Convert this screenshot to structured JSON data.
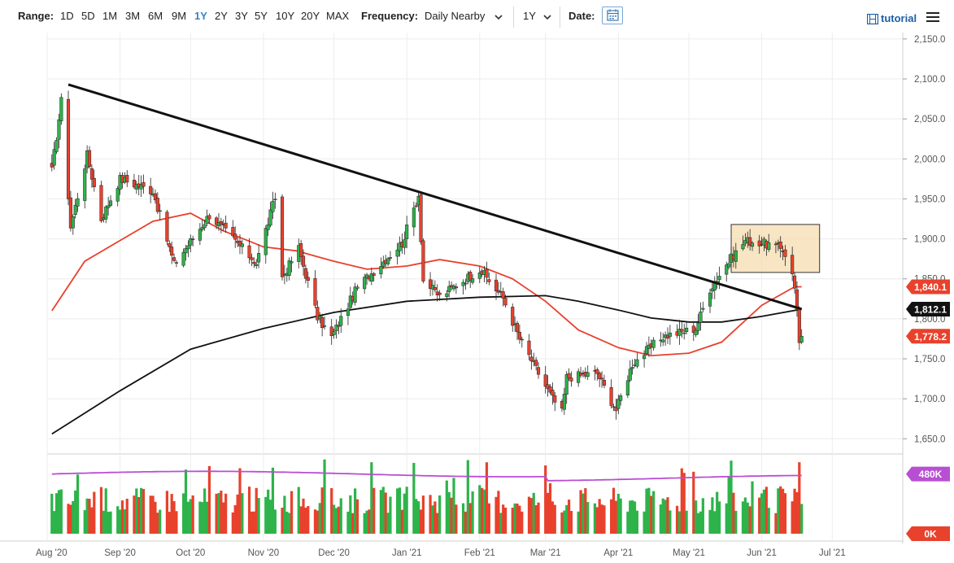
{
  "toolbar": {
    "range_label": "Range:",
    "ranges": [
      "1D",
      "5D",
      "1M",
      "3M",
      "6M",
      "9M",
      "1Y",
      "2Y",
      "3Y",
      "5Y",
      "10Y",
      "20Y",
      "MAX"
    ],
    "active_range": "1Y",
    "frequency_label": "Frequency:",
    "frequency_value": "Daily Nearby",
    "period_value": "1Y",
    "date_label": "Date:",
    "tutorial_label": "tutorial"
  },
  "icons": [
    "calendar-icon",
    "film-icon",
    "menu-icon",
    "trend-line-icon",
    "fib-lines-icon",
    "shape-icon",
    "arrow-up-icon",
    "circle-one-icon",
    "pitchfork-icon",
    "magnet-icon",
    "chevron-right-icon",
    "chevron-down-icon"
  ],
  "colors": {
    "up": "#2db34a",
    "down": "#e8412c",
    "ma_fast": "#e8412c",
    "ma_slow": "#111111",
    "vol_ma": "#b84fd3",
    "accent": "#1a5fa8",
    "box_fill": "#f6dcb0",
    "box_stroke": "#333333"
  },
  "chart_data": {
    "type": "candlestick",
    "price_axis": {
      "ticks": [
        1650,
        1700,
        1750,
        1800,
        1850,
        1900,
        1950,
        2000,
        2050,
        2100,
        2150
      ],
      "tick_labels": [
        "1,650.0",
        "1,700.0",
        "1,750.0",
        "1,800.0",
        "1,850.0",
        "1,900.0",
        "1,950.0",
        "2,000.0",
        "2,050.0",
        "2,100.0",
        "2,150.0"
      ],
      "range": [
        1632,
        2158
      ]
    },
    "x_axis": {
      "labels": [
        "Aug '20",
        "Sep '20",
        "Oct '20",
        "Nov '20",
        "Dec '20",
        "Jan '21",
        "Feb '21",
        "Mar '21",
        "Apr '21",
        "May '21",
        "Jun '21",
        "Jul '21"
      ],
      "range_dates": [
        "2020-08-01",
        "2021-07-31"
      ]
    },
    "price_tags": [
      {
        "value": 1840.1,
        "label": "1,840.1",
        "color": "#e8412c"
      },
      {
        "value": 1812.1,
        "label": "1,812.1",
        "color": "#111111"
      },
      {
        "value": 1778.2,
        "label": "1,778.2",
        "color": "#e8412c"
      }
    ],
    "volume_tags": [
      {
        "label": "480K",
        "color": "#b84fd3"
      },
      {
        "label": "0K",
        "color": "#e8412c"
      }
    ],
    "volume_axis": {
      "max": 540
    },
    "series": [
      {
        "name": "price",
        "type": "candlestick",
        "start": "2020-08-03",
        "end": "2021-06-18",
        "keypoints": [
          [
            "2020-08-03",
            1985
          ],
          [
            "2020-08-07",
            2072
          ],
          [
            "2020-08-11",
            1915
          ],
          [
            "2020-08-18",
            2005
          ],
          [
            "2020-08-24",
            1925
          ],
          [
            "2020-09-01",
            1975
          ],
          [
            "2020-09-15",
            1960
          ],
          [
            "2020-09-24",
            1868
          ],
          [
            "2020-10-09",
            1930
          ],
          [
            "2020-10-29",
            1870
          ],
          [
            "2020-11-06",
            1952
          ],
          [
            "2020-11-09",
            1852
          ],
          [
            "2020-11-16",
            1888
          ],
          [
            "2020-11-24",
            1802
          ],
          [
            "2020-11-30",
            1777
          ],
          [
            "2020-12-11",
            1840
          ],
          [
            "2020-12-30",
            1895
          ],
          [
            "2021-01-06",
            1955
          ],
          [
            "2021-01-08",
            1848
          ],
          [
            "2021-01-15",
            1828
          ],
          [
            "2021-02-01",
            1862
          ],
          [
            "2021-02-11",
            1826
          ],
          [
            "2021-02-18",
            1775
          ],
          [
            "2021-03-04",
            1700
          ],
          [
            "2021-03-08",
            1683
          ],
          [
            "2021-03-10",
            1727
          ],
          [
            "2021-03-23",
            1732
          ],
          [
            "2021-03-31",
            1686
          ],
          [
            "2021-04-07",
            1744
          ],
          [
            "2021-04-20",
            1778
          ],
          [
            "2021-05-04",
            1788
          ],
          [
            "2021-05-10",
            1838
          ],
          [
            "2021-05-17",
            1868
          ],
          [
            "2021-05-25",
            1898
          ],
          [
            "2021-06-04",
            1893
          ],
          [
            "2021-06-10",
            1887
          ],
          [
            "2021-06-14",
            1860
          ],
          [
            "2021-06-16",
            1812
          ],
          [
            "2021-06-17",
            1774
          ],
          [
            "2021-06-18",
            1778
          ]
        ]
      },
      {
        "name": "50-day moving average",
        "type": "line",
        "points": [
          [
            "2020-08-03",
            1810
          ],
          [
            "2020-08-17",
            1872
          ],
          [
            "2020-09-01",
            1898
          ],
          [
            "2020-09-15",
            1922
          ],
          [
            "2020-10-01",
            1932
          ],
          [
            "2020-10-15",
            1910
          ],
          [
            "2020-11-01",
            1890
          ],
          [
            "2020-11-15",
            1885
          ],
          [
            "2020-12-01",
            1872
          ],
          [
            "2020-12-15",
            1862
          ],
          [
            "2021-01-01",
            1866
          ],
          [
            "2021-01-15",
            1874
          ],
          [
            "2021-02-01",
            1866
          ],
          [
            "2021-02-15",
            1850
          ],
          [
            "2021-03-01",
            1822
          ],
          [
            "2021-03-15",
            1786
          ],
          [
            "2021-04-01",
            1764
          ],
          [
            "2021-04-15",
            1754
          ],
          [
            "2021-05-01",
            1757
          ],
          [
            "2021-05-15",
            1771
          ],
          [
            "2021-06-01",
            1817
          ],
          [
            "2021-06-15",
            1840.1
          ],
          [
            "2021-06-18",
            1840.1
          ]
        ]
      },
      {
        "name": "200-day moving average",
        "type": "line",
        "points": [
          [
            "2020-08-03",
            1656
          ],
          [
            "2020-09-01",
            1710
          ],
          [
            "2020-10-01",
            1762
          ],
          [
            "2020-11-01",
            1788
          ],
          [
            "2020-12-01",
            1808
          ],
          [
            "2021-01-01",
            1822
          ],
          [
            "2021-02-01",
            1827
          ],
          [
            "2021-03-01",
            1829
          ],
          [
            "2021-03-15",
            1822
          ],
          [
            "2021-04-01",
            1811
          ],
          [
            "2021-04-15",
            1801
          ],
          [
            "2021-05-01",
            1796
          ],
          [
            "2021-05-15",
            1796
          ],
          [
            "2021-06-01",
            1803
          ],
          [
            "2021-06-18",
            1812.1
          ]
        ]
      },
      {
        "name": "trend line",
        "type": "line",
        "points": [
          [
            "2020-08-10",
            2093
          ],
          [
            "2021-06-18",
            1812.1
          ]
        ]
      },
      {
        "name": "consolidation box",
        "type": "rect",
        "x": [
          "2021-05-19",
          "2021-06-18"
        ],
        "y": [
          1858,
          1918
        ]
      },
      {
        "name": "volume",
        "type": "bar"
      },
      {
        "name": "volume moving average",
        "type": "line"
      }
    ]
  }
}
